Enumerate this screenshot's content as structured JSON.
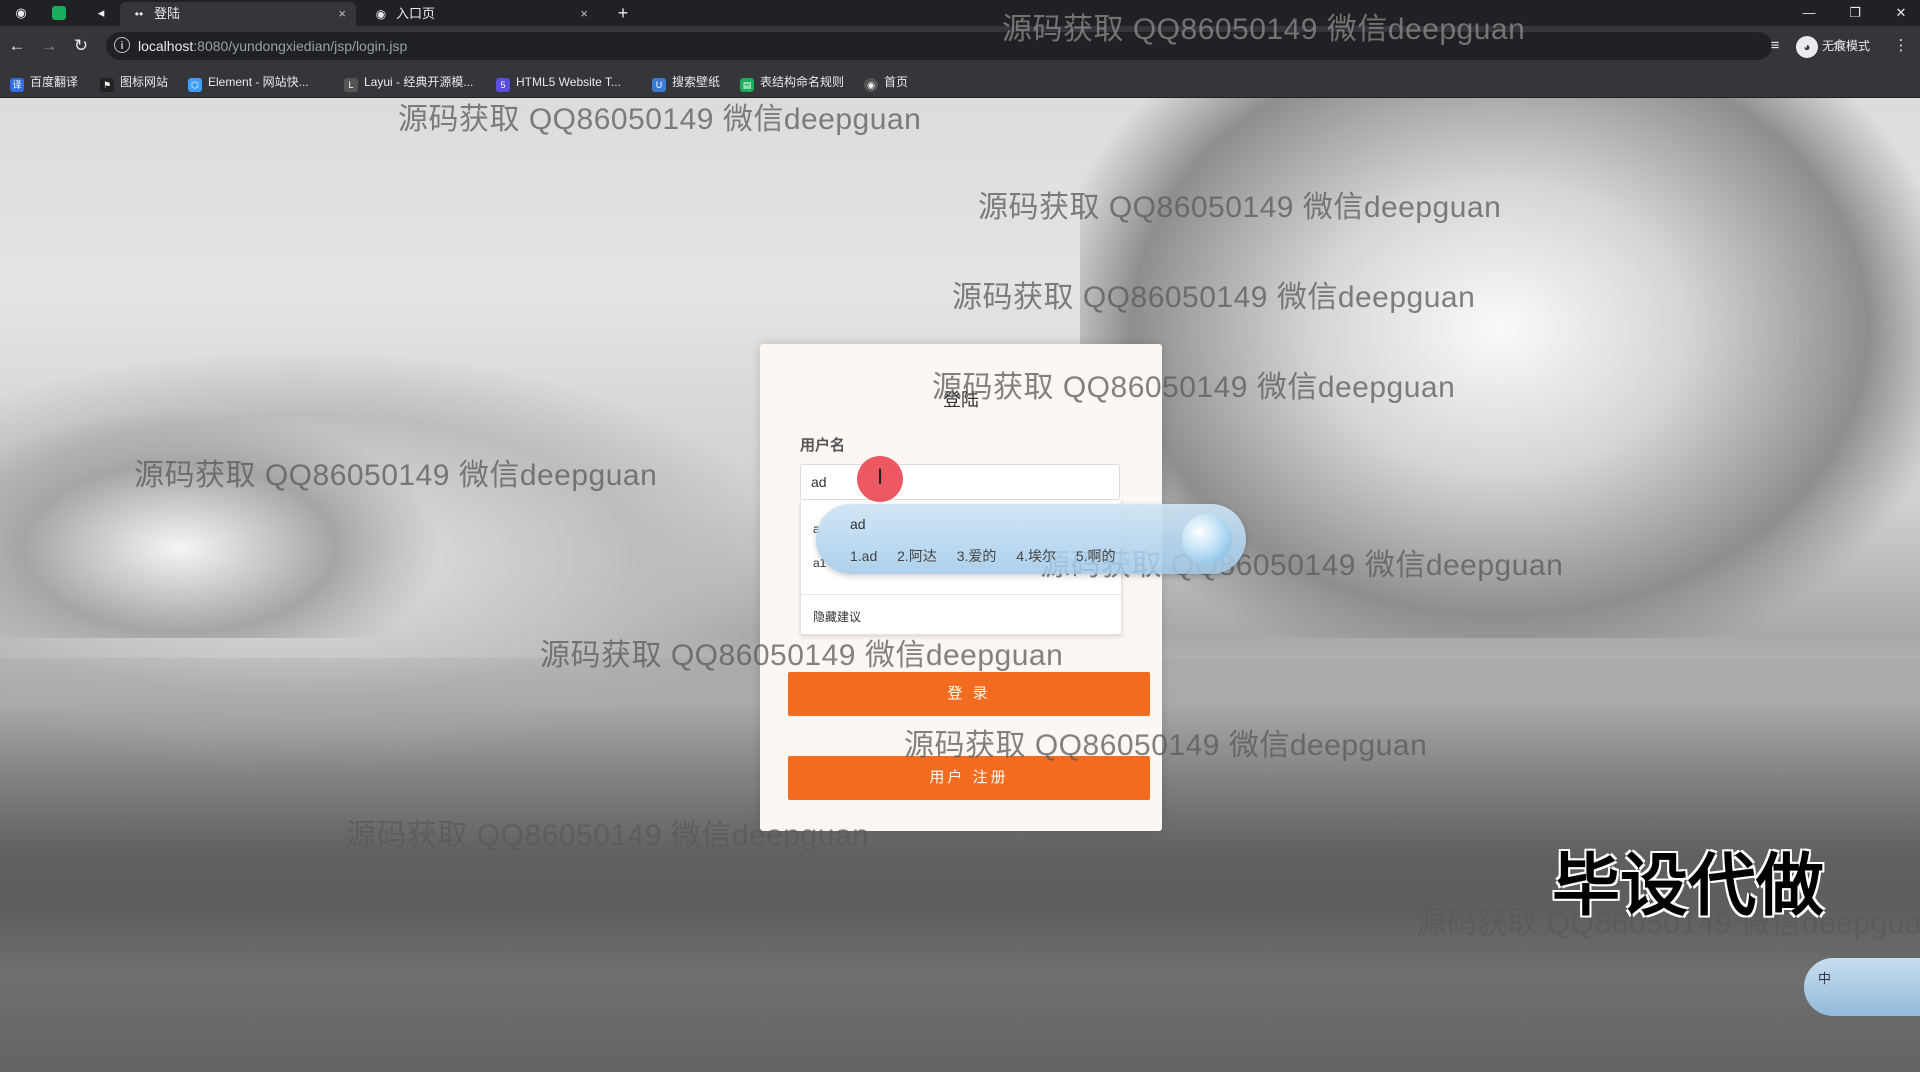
{
  "tabs": [
    {
      "label": "登陆",
      "close": "×",
      "icon": "dots-icon",
      "active": true
    },
    {
      "label": "入口页",
      "close": "×",
      "icon": "globe-icon",
      "active": false
    }
  ],
  "browser": {
    "url_host": "localhost",
    "url_rest": ":8080/yundongxiedian/jsp/login.jsp",
    "incognito_label": "无痕模式"
  },
  "bookmarks": [
    {
      "label": "百度翻译",
      "color": "#2f6ee5"
    },
    {
      "label": "图标网站",
      "color": "#222222"
    },
    {
      "label": "Element - 网站快...",
      "color": "#409eff"
    },
    {
      "label": "Layui - 经典开源模...",
      "color": "#555555"
    },
    {
      "label": "HTML5 Website T...",
      "color": "#5b4de0"
    },
    {
      "label": "搜索壁纸",
      "color": "#3a7bd5"
    },
    {
      "label": "表结构命名规则",
      "color": "#1aad5b"
    },
    {
      "label": "首页",
      "color": "#555555"
    }
  ],
  "login": {
    "title": "登陆",
    "username_label": "用户名",
    "username_value": "ad",
    "suggestions": [
      "a",
      "a1"
    ],
    "hide_suggestions": "隐藏建议",
    "login_button": "登 录",
    "register_button": "用户 注册"
  },
  "ime": {
    "input": "ad",
    "candidates": [
      "1.ad",
      "2.阿达",
      "3.爱的",
      "4.埃尔",
      "5.啊的"
    ],
    "mode": "中"
  },
  "watermarks": [
    "源码获取 QQ86050149 微信deepguan",
    "源码获取 QQ86050149 微信deepguan",
    "源码获取 QQ86050149 微信deepguan",
    "源码获取 QQ86050149 微信deepguan",
    "源码获取 QQ86050149 微信deepguan",
    "源码获取 QQ86050149 微信deepguan",
    "源码获取 QQ86050149 微信deepguan",
    "源码获取 QQ86050149 微信deepguan",
    "源码获取 QQ86050149 微信deepguan",
    "源码获取 QQ86050149 微信deepguan",
    "源码获取 QQ86050149 微信deepguan"
  ],
  "brand_text": "毕设代做",
  "colors": {
    "accent": "#f26b1f",
    "card_bg": "#fcf7f3",
    "chrome_dark": "#202124",
    "chrome_toolbar": "#35363a"
  }
}
